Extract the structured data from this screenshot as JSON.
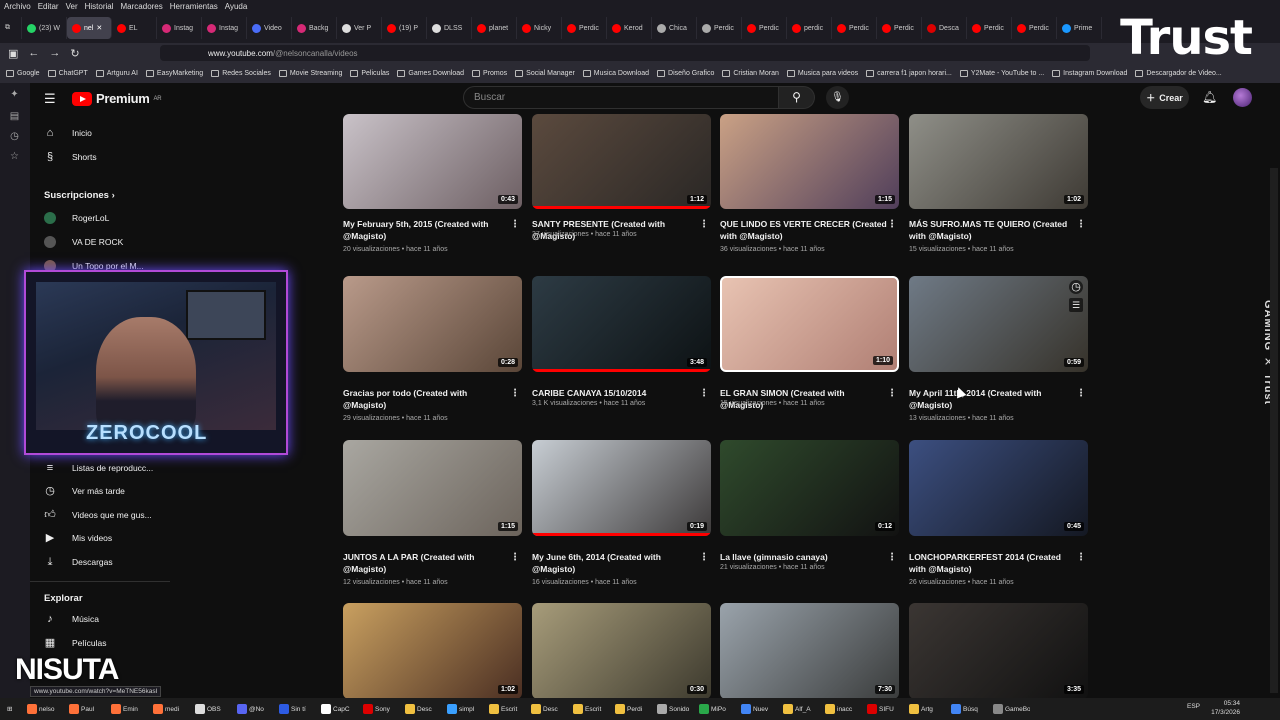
{
  "browser": {
    "menu": [
      "Archivo",
      "Editar",
      "Ver",
      "Historial",
      "Marcadores",
      "Herramientas",
      "Ayuda"
    ],
    "tabs": [
      {
        "label": "(23) W",
        "color": "#25d366"
      },
      {
        "label": "nel",
        "color": "#ff0000",
        "active": true
      },
      {
        "label": "EL",
        "color": "#ff0000"
      },
      {
        "label": "Instag",
        "color": "#d62976"
      },
      {
        "label": "Instag",
        "color": "#d62976"
      },
      {
        "label": "Video",
        "color": "#4a6cf7"
      },
      {
        "label": "Backg",
        "color": "#d62976"
      },
      {
        "label": "Ver P",
        "color": "#ddd"
      },
      {
        "label": "(19) P",
        "color": "#ff0000"
      },
      {
        "label": "DLSS",
        "color": "#ddd"
      },
      {
        "label": "planet",
        "color": "#ff0000"
      },
      {
        "label": "Nicky",
        "color": "#ff0000"
      },
      {
        "label": "Perdic",
        "color": "#ff0000"
      },
      {
        "label": "Kerod",
        "color": "#ff0000"
      },
      {
        "label": "Chica",
        "color": "#aaa"
      },
      {
        "label": "Perdic",
        "color": "#aaa"
      },
      {
        "label": "Perdic",
        "color": "#ff0000"
      },
      {
        "label": "perdic",
        "color": "#ff0000"
      },
      {
        "label": "Perdic",
        "color": "#ff0000"
      },
      {
        "label": "Perdic",
        "color": "#ff0000"
      },
      {
        "label": "Desca",
        "color": "#d00"
      },
      {
        "label": "Perdic",
        "color": "#ff0000"
      },
      {
        "label": "Perdic",
        "color": "#ff0000"
      },
      {
        "label": "Prime",
        "color": "#1a98ff"
      }
    ],
    "url_host": "www.youtube.com",
    "url_path": "/@nelsoncanalla/videos",
    "bookmarks": [
      "Google",
      "ChatGPT",
      "Artguru AI",
      "EasyMarketing",
      "Redes Sociales",
      "Movie Streaming",
      "Peliculas",
      "Games Download",
      "Promos",
      "Social Manager",
      "Musica Download",
      "Diseño Grafico",
      "Cristian Moran",
      "Musica para videos",
      "carrera f1 japon horari...",
      "Y2Mate - YouTube to ...",
      "Instagram Download",
      "Descargador de Video..."
    ]
  },
  "overlays": {
    "trust_logo": "Trust",
    "gaming_trust": "GAMING ✕ Trust",
    "nisuta": "NISUTA",
    "zerocool": "ZEROCOOL",
    "status_url": "www.youtube.com/watch?v=MeTNE56kasI"
  },
  "youtube": {
    "logo_text": "Premium",
    "logo_region": "AR",
    "search_placeholder": "Buscar",
    "create_label": "Crear",
    "sidebar": {
      "home": "Inicio",
      "shorts": "Shorts",
      "subs_heading": "Suscripciones",
      "subs": [
        "RogerLoL",
        "VA DE ROCK",
        "Un Topo por el M..."
      ],
      "you_items": [
        "Listas de reproducc...",
        "Ver más tarde",
        "Videos que me gus...",
        "Mis videos",
        "Descargas"
      ],
      "explore_heading": "Explorar",
      "explore_items": [
        "Música",
        "Películas"
      ]
    },
    "videos": [
      {
        "title": "My February 5th, 2015 (Created with @Magisto)",
        "views": "20 visualizaciones",
        "age": "hace 11 años",
        "duration": "0:43",
        "c1": "#c9c2c8",
        "c2": "#6d5f63"
      },
      {
        "title": "SANTY PRESENTE (Created with @Magisto)",
        "views": "37 visualizaciones",
        "age": "hace 11 años",
        "duration": "1:12",
        "c1": "#5b4a3e",
        "c2": "#2a2725"
      },
      {
        "title": "QUE LINDO ES VERTE CRECER (Created with @Magisto)",
        "views": "36 visualizaciones",
        "age": "hace 11 años",
        "duration": "1:15",
        "c1": "#caa185",
        "c2": "#503e5a"
      },
      {
        "title": "MÁS SUFRO.MAS TE QUIERO (Created with @Magisto)",
        "views": "15 visualizaciones",
        "age": "hace 11 años",
        "duration": "1:02",
        "c1": "#8f8f88",
        "c2": "#3e3a34"
      },
      {
        "title": "Gracias por todo (Created with @Magisto)",
        "views": "29 visualizaciones",
        "age": "hace 11 años",
        "duration": "0:28",
        "c1": "#b99a8a",
        "c2": "#5a4638"
      },
      {
        "title": "CARIBE CANAYA 15/10/2014",
        "views": "3,1 K visualizaciones",
        "age": "hace 11 años",
        "duration": "3:48",
        "c1": "#2d3b44",
        "c2": "#0d1214"
      },
      {
        "title": "EL GRAN SIMON (Created with @Magisto)",
        "views": "15 visualizaciones",
        "age": "hace 11 años",
        "duration": "1:10",
        "c1": "#e8c3b2",
        "c2": "#b07f74"
      },
      {
        "title": "My April 11th, 2014 (Created with @Magisto)",
        "views": "13 visualizaciones",
        "age": "hace 11 años",
        "duration": "0:59",
        "c1": "#6f7a86",
        "c2": "#36322a"
      },
      {
        "title": "JUNTOS A LA PAR (Created with @Magisto)",
        "views": "12 visualizaciones",
        "age": "hace 11 años",
        "duration": "1:15",
        "c1": "#a9a7a1",
        "c2": "#6c645c"
      },
      {
        "title": "My June 6th, 2014 (Created with @Magisto)",
        "views": "16 visualizaciones",
        "age": "hace 11 años",
        "duration": "0:19",
        "c1": "#c7cdd3",
        "c2": "#3d3a3a"
      },
      {
        "title": "La llave (gimnasio canaya)",
        "views": "21 visualizaciones",
        "age": "hace 11 años",
        "duration": "0:12",
        "c1": "#2f4a2c",
        "c2": "#121212"
      },
      {
        "title": "LONCHOPARKERFEST 2014 (Created with @Magisto)",
        "views": "26 visualizaciones",
        "age": "hace 11 años",
        "duration": "0:45",
        "c1": "#3c4f80",
        "c2": "#141822"
      },
      {
        "title": "",
        "views": "",
        "age": "",
        "duration": "1:02",
        "c1": "#c9a060",
        "c2": "#4a2e22"
      },
      {
        "title": "",
        "views": "",
        "age": "",
        "duration": "0:30",
        "c1": "#a79c7a",
        "c2": "#3d3a2e"
      },
      {
        "title": "",
        "views": "",
        "age": "",
        "duration": "7:30",
        "c1": "#9aa3ab",
        "c2": "#3a3c3c"
      },
      {
        "title": "",
        "views": "",
        "age": "",
        "duration": "3:35",
        "c1": "#3b3633",
        "c2": "#111"
      }
    ]
  },
  "taskbar": {
    "items": [
      {
        "label": "nelso",
        "color": "#ff7139"
      },
      {
        "label": "Paul",
        "color": "#ff7139"
      },
      {
        "label": "Emin",
        "color": "#ff7139"
      },
      {
        "label": "medi",
        "color": "#ff7139"
      },
      {
        "label": "OBS",
        "color": "#ddd"
      },
      {
        "label": "@No",
        "color": "#5865f2"
      },
      {
        "label": "Sin tí",
        "color": "#2d5be3"
      },
      {
        "label": "CapC",
        "color": "#fff"
      },
      {
        "label": "Sony",
        "color": "#d00"
      },
      {
        "label": "Desc",
        "color": "#f0c040"
      },
      {
        "label": "simpl",
        "color": "#3aa0ff"
      },
      {
        "label": "Escrit",
        "color": "#f0c040"
      },
      {
        "label": "Desc",
        "color": "#f0c040"
      },
      {
        "label": "Escrit",
        "color": "#f0c040"
      },
      {
        "label": "Perdi",
        "color": "#f0c040"
      },
      {
        "label": "Sonido",
        "color": "#aaa"
      },
      {
        "label": "MiPo",
        "color": "#2aa84a"
      },
      {
        "label": "Nuev",
        "color": "#4285f4"
      },
      {
        "label": "Alf_A",
        "color": "#f0c040"
      },
      {
        "label": "inacc",
        "color": "#f0c040"
      },
      {
        "label": "SIFU",
        "color": "#d00"
      },
      {
        "label": "Artg",
        "color": "#f0c040"
      },
      {
        "label": "Búsq",
        "color": "#4285f4"
      },
      {
        "label": "GameBox",
        "color": "#888"
      }
    ],
    "lang": "ESP",
    "time": "05:34",
    "date": "17/3/2026"
  },
  "colors": {
    "accent": "#ff0000",
    "background": "#0f0f0f",
    "webcam_border": "#b14ad8"
  }
}
